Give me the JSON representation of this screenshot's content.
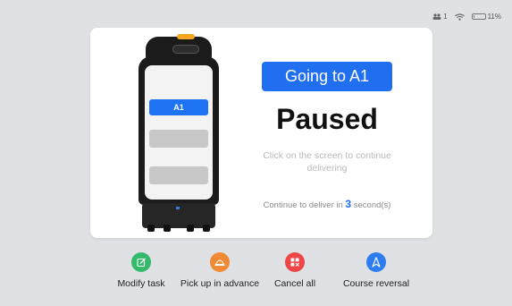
{
  "status_bar": {
    "user_count": "1",
    "battery_percent": "11%",
    "battery_level": 0.11
  },
  "robot_screen": {
    "task_label": "A1"
  },
  "dialog": {
    "destination_label": "Going to A1",
    "title": "Paused",
    "hint": "Click on the screen to continue delivering",
    "countdown_prefix": "Continue to deliver in ",
    "countdown_value": "3",
    "countdown_suffix": " second(s)"
  },
  "actions": [
    {
      "label": "Modify task",
      "icon": "edit-icon",
      "color": "#35b96a"
    },
    {
      "label": "Pick up in advance",
      "icon": "cloche-icon",
      "color": "#f08a35"
    },
    {
      "label": "Cancel all",
      "icon": "cancel-grid-icon",
      "color": "#ee4547"
    },
    {
      "label": "Course reversal",
      "icon": "navigation-icon",
      "color": "#2e7df0"
    }
  ]
}
